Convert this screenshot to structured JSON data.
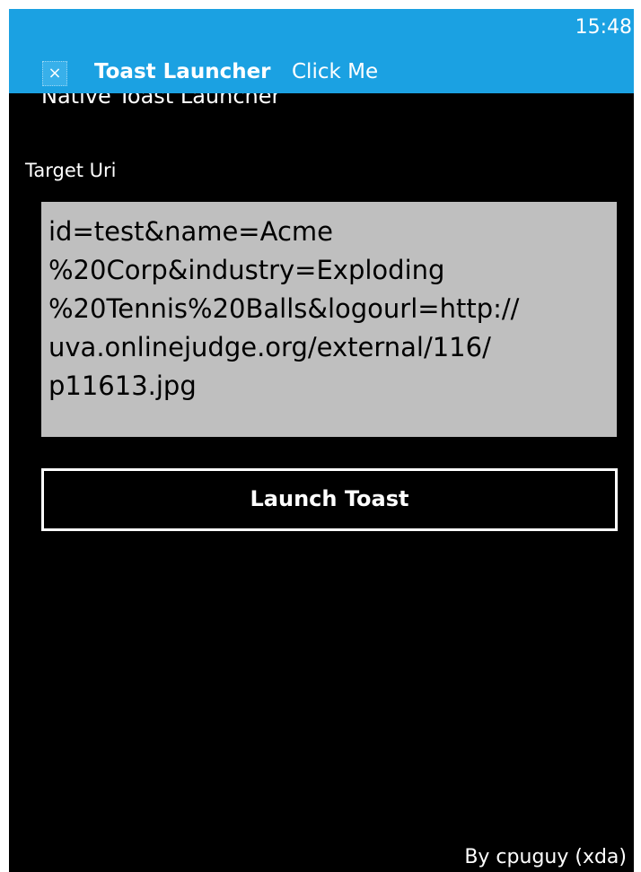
{
  "status_bar": {
    "time": "15:48"
  },
  "toast": {
    "icon": "close-icon",
    "icon_glyph": "×",
    "title": "Toast Launcher",
    "content": "Click Me",
    "color": "#1ba1e2"
  },
  "app": {
    "title": "Native Toast Launcher"
  },
  "form": {
    "target_uri_label": "Target Uri",
    "target_uri_lines": [
      "id=test&name=Acme",
      "%20Corp&industry=Exploding",
      "%20Tennis%20Balls&logourl=http://",
      "uva.onlinejudge.org/external/116/",
      "p11613.jpg"
    ],
    "launch_button_label": "Launch Toast"
  },
  "footer": {
    "credit": "By cpuguy (xda)"
  }
}
